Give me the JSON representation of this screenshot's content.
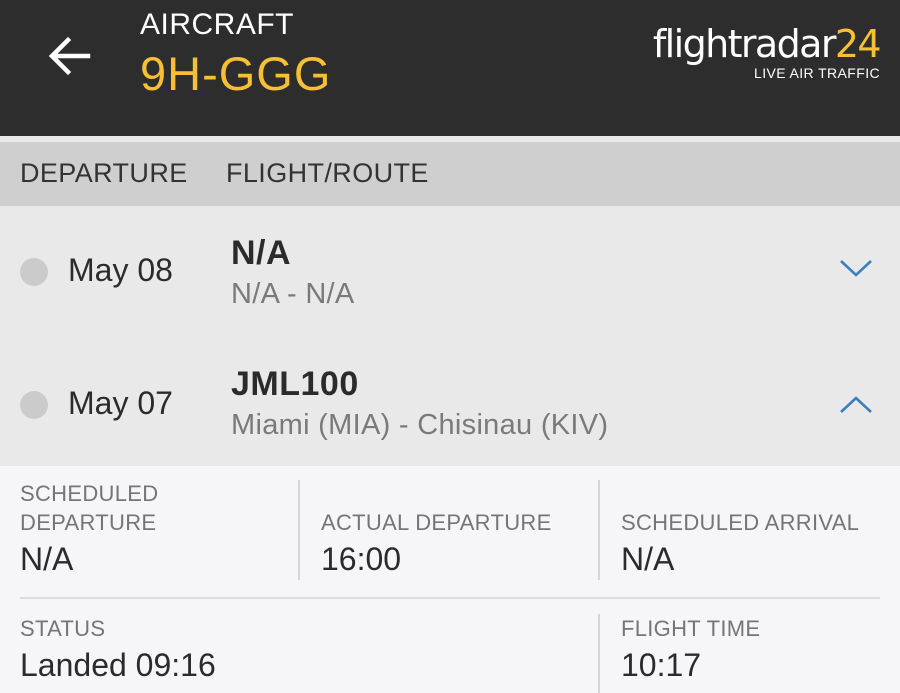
{
  "header": {
    "label": "AIRCRAFT",
    "registration": "9H-GGG",
    "logo_main": "flightradar",
    "logo_num": "24",
    "logo_sub": "LIVE AIR TRAFFIC"
  },
  "columns": {
    "departure": "DEPARTURE",
    "flight_route": "FLIGHT/ROUTE"
  },
  "flights": [
    {
      "date": "May 08",
      "flight": "N/A",
      "route": "N/A - N/A",
      "expanded": false
    },
    {
      "date": "May 07",
      "flight": "JML100",
      "route": "Miami (MIA) - Chisinau (KIV)",
      "expanded": true
    }
  ],
  "details": {
    "scheduled_departure_label": "SCHEDULED\nDEPARTURE",
    "scheduled_departure_value": "N/A",
    "actual_departure_label": "ACTUAL DEPARTURE",
    "actual_departure_value": "16:00",
    "scheduled_arrival_label": "SCHEDULED ARRIVAL",
    "scheduled_arrival_value": "N/A",
    "status_label": "STATUS",
    "status_value": "Landed 09:16",
    "flight_time_label": "FLIGHT TIME",
    "flight_time_value": "10:17"
  },
  "colors": {
    "header_bg": "#2d2d2d",
    "accent": "#f7c034",
    "chevron": "#3a7fc1"
  },
  "icons": {
    "back": "arrow-left-icon",
    "collapsed": "chevron-down-icon",
    "expanded": "chevron-up-icon"
  }
}
